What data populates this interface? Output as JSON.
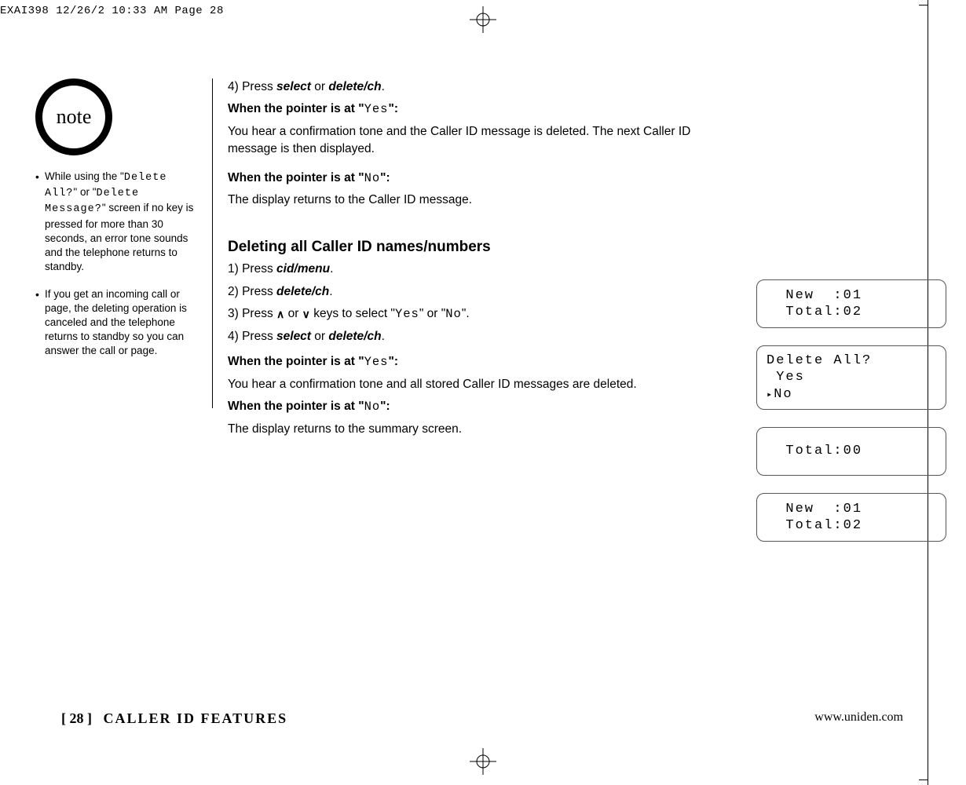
{
  "print_header": "EXAI398  12/26/2  10:33 AM  Page 28",
  "note_label": "note",
  "sidebar": {
    "bullet1_a": "While using the \"",
    "bullet1_code1": "Delete All?",
    "bullet1_b": "\" or \"",
    "bullet1_code2": "Delete Message?",
    "bullet1_c": "\" screen if no key is pressed for more than 30 seconds, an error tone sounds and the telephone returns to standby.",
    "bullet2": "If you get an incoming call or page, the deleting operation is canceled and the telephone returns to standby so you can answer the call or page."
  },
  "main": {
    "s4_a": "4) Press ",
    "s4_sel": "select",
    "s4_or": " or ",
    "s4_del": "delete/ch",
    "s4_end": ".",
    "yes_head_a": "When the pointer is at \"",
    "yes_code": "Yes",
    "yes_head_b": "\":",
    "yes_body1": "You hear a confirmation tone and the Caller ID message is deleted. The next Caller ID message is then displayed.",
    "no_head_a": "When the pointer is at \"",
    "no_code": "No",
    "no_head_b": "\":",
    "no_body1": "The display returns to the Caller ID message.",
    "h2": "Deleting all Caller ID names/numbers",
    "d1_a": "1) Press ",
    "d1_cmd": "cid/menu",
    "d1_end": ".",
    "d2_a": "2) Press ",
    "d2_cmd": "delete/ch",
    "d2_end": ".",
    "d3_a": "3) Press ",
    "d3_b": " or ",
    "d3_c": " keys to select \"",
    "d3_yes": "Yes",
    "d3_d": "\" or \"",
    "d3_no": "No",
    "d3_e": "\".",
    "d4_a": "4) Press ",
    "d4_sel": "select",
    "d4_or": " or ",
    "d4_del": "delete/ch",
    "d4_end": ".",
    "yes2_body": "You hear a confirmation tone and all stored Caller ID messages are deleted.",
    "no2_body": "The display returns to the summary screen."
  },
  "lcd": {
    "box1_l1": "  New  :01",
    "box1_l2": "  Total:02",
    "box2_l1": "Delete All?",
    "box2_l2": " Yes",
    "box2_l3": "No",
    "box3_l1": "",
    "box3_l2": "  Total:00",
    "box4_l1": "  New  :01",
    "box4_l2": "  Total:02"
  },
  "footer": {
    "page": "[ 28 ]",
    "section": "CALLER ID FEATURES",
    "url": "www.uniden.com"
  }
}
